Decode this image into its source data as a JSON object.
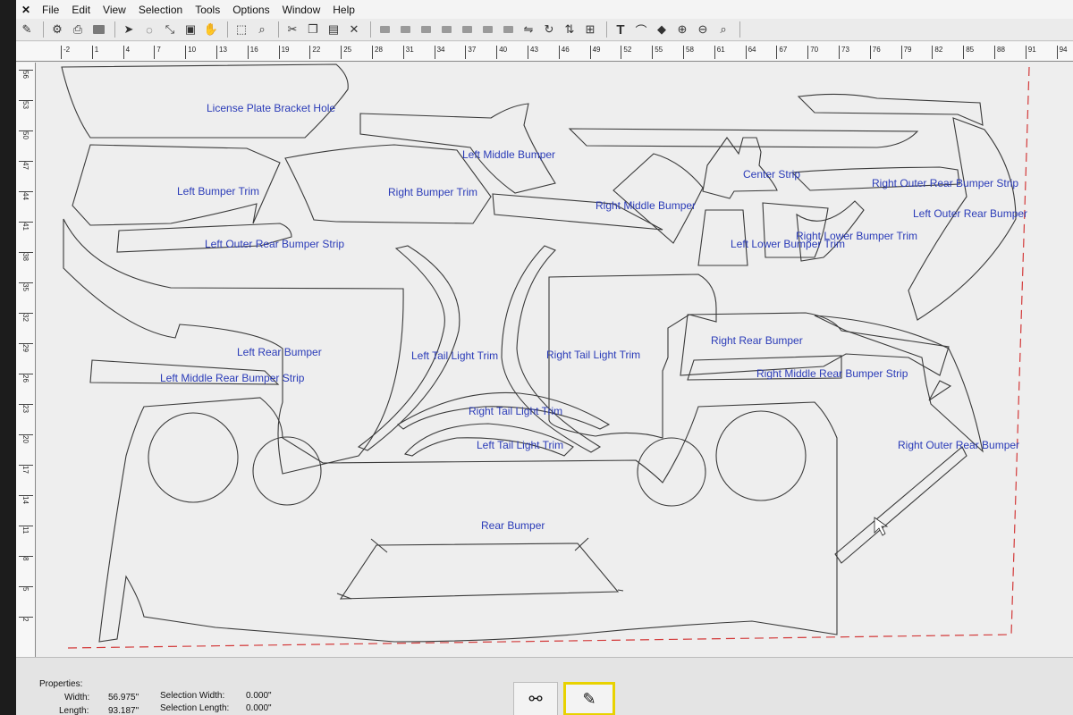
{
  "menu": [
    "File",
    "Edit",
    "View",
    "Selection",
    "Tools",
    "Options",
    "Window",
    "Help"
  ],
  "ruler": {
    "horizontal": [
      "-2",
      "1",
      "4",
      "7",
      "10",
      "13",
      "16",
      "19",
      "22",
      "25",
      "28",
      "31",
      "34",
      "37",
      "40",
      "43",
      "46",
      "49",
      "52",
      "55",
      "58",
      "61",
      "64",
      "67",
      "70",
      "73",
      "76",
      "79",
      "82",
      "85",
      "88",
      "91",
      "94"
    ],
    "vertical": [
      "56",
      "53",
      "50",
      "47",
      "44",
      "41",
      "38",
      "35",
      "32",
      "29",
      "26",
      "23",
      "20",
      "17",
      "14",
      "11",
      "8",
      "5",
      "2"
    ]
  },
  "parts": [
    "License Plate Bracket Hole",
    "Left Middle Bumper",
    "Center Strip",
    "Right Outer Rear Bumper Strip",
    "Left Bumper Trim",
    "Right Bumper Trim",
    "Right Middle Bumper",
    "Left Outer Rear Bumper",
    "Right Lower Bumper Trim",
    "Left Outer Rear Bumper Strip",
    "Left Lower Bumper Trim",
    "Right Rear Bumper",
    "Left Rear Bumper",
    "Left Tail Light Trim",
    "Right Tail Light Trim",
    "Right Middle Rear Bumper Strip",
    "Left Middle Rear Bumper Strip",
    "Right Tail Light Trim",
    "Left Tail Light Trim",
    "Right Outer Rear Bumper",
    "Rear Bumper"
  ],
  "properties": {
    "title": "Properties:",
    "width_label": "Width:",
    "width_value": "56.975\"",
    "length_label": "Length:",
    "length_value": "93.187\"",
    "sel_width_label": "Selection Width:",
    "sel_width_value": "0.000\"",
    "sel_length_label": "Selection Length:",
    "sel_length_value": "0.000\""
  },
  "tools": [
    {
      "icon": "binoculars-icon",
      "active": false
    },
    {
      "icon": "pen-icon",
      "active": true
    }
  ],
  "colors": {
    "outline": "#3a3a3a",
    "label": "#2a3bb8",
    "boundary": "#d33a3a"
  }
}
